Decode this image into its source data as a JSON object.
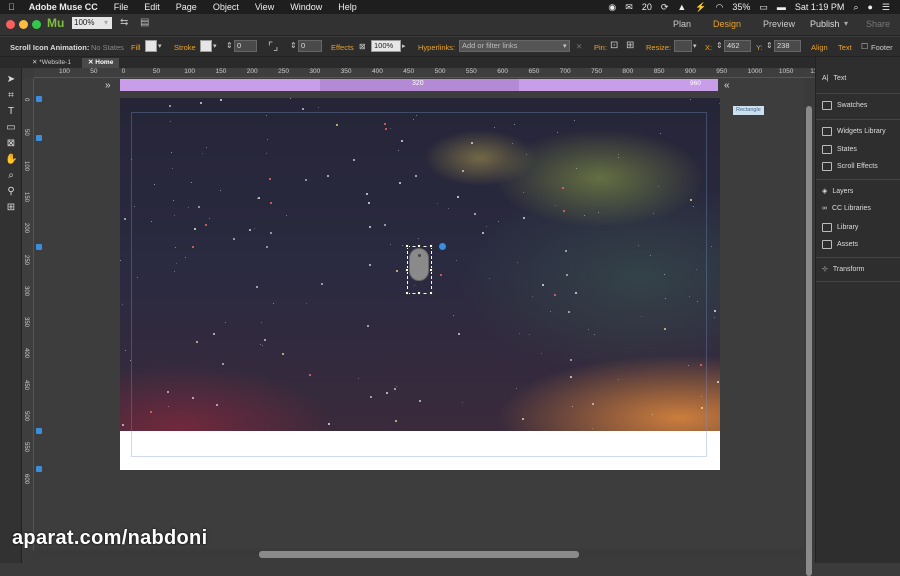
{
  "menubar": {
    "apple": "",
    "app_name": "Adobe Muse CC",
    "items": [
      "File",
      "Edit",
      "Page",
      "Object",
      "View",
      "Window",
      "Help"
    ],
    "status": {
      "badge": "20",
      "battery": "35%",
      "clock": "Sat 1:19 PM"
    }
  },
  "appbar": {
    "logo": "Mu",
    "zoom": "100%",
    "modes": [
      "Plan",
      "Design",
      "Preview"
    ],
    "active_mode": "Design",
    "publish": "Publish",
    "share": "Share"
  },
  "control": {
    "scroll_label": "Scroll Icon Animation:",
    "scroll_value": "No States",
    "fill": "Fill",
    "stroke": "Stroke",
    "stroke_value": "0",
    "radius_value": "0",
    "effects": "Effects",
    "opacity": "100%",
    "hyperlinks": "Hyperlinks:",
    "hyperlinks_placeholder": "Add or filter links",
    "pin": "Pin:",
    "resize": "Resize:",
    "x_label": "X:",
    "x_value": "462",
    "y_label": "Y:",
    "y_value": "238",
    "align": "Align",
    "text": "Text",
    "footer": "Footer"
  },
  "tabs": [
    {
      "label": "*Website-1"
    },
    {
      "label": "Home"
    }
  ],
  "ruler_h": [
    "100",
    "50",
    "0",
    "50",
    "100",
    "150",
    "200",
    "250",
    "300",
    "350",
    "400",
    "450",
    "500",
    "550",
    "600",
    "650",
    "700",
    "750",
    "800",
    "850",
    "900",
    "950",
    "1000",
    "1050",
    "11"
  ],
  "ruler_v": [
    "0",
    "50",
    "100",
    "150",
    "200",
    "250",
    "300",
    "350",
    "400",
    "450",
    "500",
    "550",
    "600"
  ],
  "breakpoint": {
    "label": "320",
    "right_label": "960"
  },
  "tooltip": "Rectangle",
  "panel": {
    "items": [
      "Text",
      "Swatches",
      "Widgets Library",
      "States",
      "Scroll Effects",
      "Layers",
      "CC Libraries",
      "Library",
      "Assets",
      "Transform"
    ]
  },
  "watermark": "aparat.com/nabdoni",
  "colors": {
    "accent": "#e8a22c",
    "breakpoint": "#c89ee8",
    "selection": "#3a8de0"
  }
}
